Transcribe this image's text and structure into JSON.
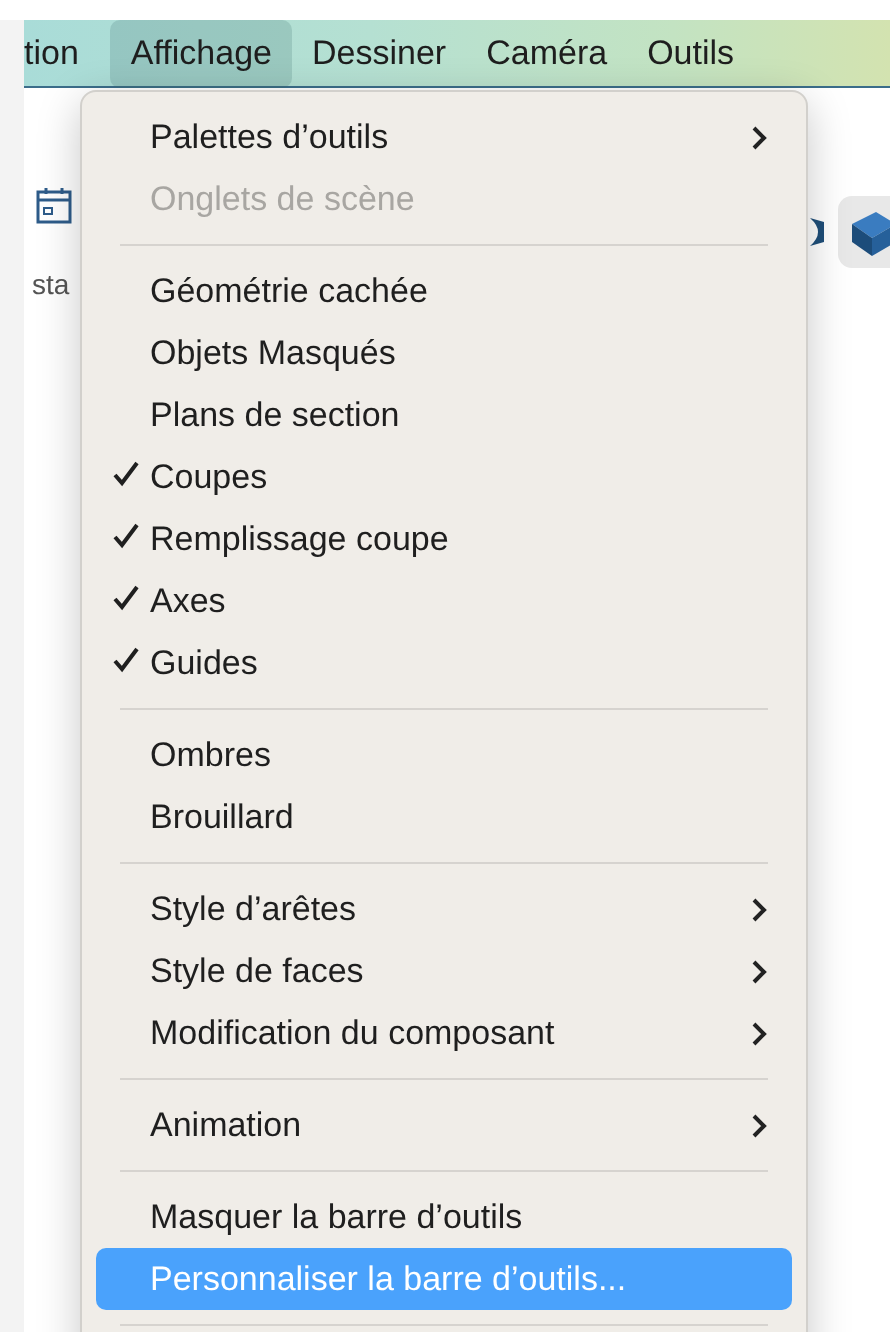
{
  "menubar": [
    {
      "label": "tion",
      "selected": false
    },
    {
      "label": "Affichage",
      "selected": true
    },
    {
      "label": "Dessiner",
      "selected": false
    },
    {
      "label": "Caméra",
      "selected": false
    },
    {
      "label": "Outils",
      "selected": false
    }
  ],
  "toolbar": {
    "label": "sta"
  },
  "menu": [
    {
      "kind": "item",
      "label": "Palettes d’outils",
      "submenu": true,
      "checked": false,
      "disabled": false,
      "selected": false
    },
    {
      "kind": "item",
      "label": "Onglets de scène",
      "submenu": false,
      "checked": false,
      "disabled": true,
      "selected": false
    },
    {
      "kind": "separator"
    },
    {
      "kind": "item",
      "label": "Géométrie cachée",
      "submenu": false,
      "checked": false,
      "disabled": false,
      "selected": false
    },
    {
      "kind": "item",
      "label": "Objets Masqués",
      "submenu": false,
      "checked": false,
      "disabled": false,
      "selected": false
    },
    {
      "kind": "item",
      "label": "Plans de section",
      "submenu": false,
      "checked": false,
      "disabled": false,
      "selected": false
    },
    {
      "kind": "item",
      "label": "Coupes",
      "submenu": false,
      "checked": true,
      "disabled": false,
      "selected": false
    },
    {
      "kind": "item",
      "label": "Remplissage coupe",
      "submenu": false,
      "checked": true,
      "disabled": false,
      "selected": false
    },
    {
      "kind": "item",
      "label": "Axes",
      "submenu": false,
      "checked": true,
      "disabled": false,
      "selected": false
    },
    {
      "kind": "item",
      "label": "Guides",
      "submenu": false,
      "checked": true,
      "disabled": false,
      "selected": false
    },
    {
      "kind": "separator"
    },
    {
      "kind": "item",
      "label": "Ombres",
      "submenu": false,
      "checked": false,
      "disabled": false,
      "selected": false
    },
    {
      "kind": "item",
      "label": "Brouillard",
      "submenu": false,
      "checked": false,
      "disabled": false,
      "selected": false
    },
    {
      "kind": "separator"
    },
    {
      "kind": "item",
      "label": "Style d’arêtes",
      "submenu": true,
      "checked": false,
      "disabled": false,
      "selected": false
    },
    {
      "kind": "item",
      "label": "Style de faces",
      "submenu": true,
      "checked": false,
      "disabled": false,
      "selected": false
    },
    {
      "kind": "item",
      "label": "Modification du composant",
      "submenu": true,
      "checked": false,
      "disabled": false,
      "selected": false
    },
    {
      "kind": "separator"
    },
    {
      "kind": "item",
      "label": "Animation",
      "submenu": true,
      "checked": false,
      "disabled": false,
      "selected": false
    },
    {
      "kind": "separator"
    },
    {
      "kind": "item",
      "label": "Masquer la barre d’outils",
      "submenu": false,
      "checked": false,
      "disabled": false,
      "selected": false
    },
    {
      "kind": "item",
      "label": "Personnaliser la barre d’outils...",
      "submenu": false,
      "checked": false,
      "disabled": false,
      "selected": true
    },
    {
      "kind": "separator"
    }
  ]
}
